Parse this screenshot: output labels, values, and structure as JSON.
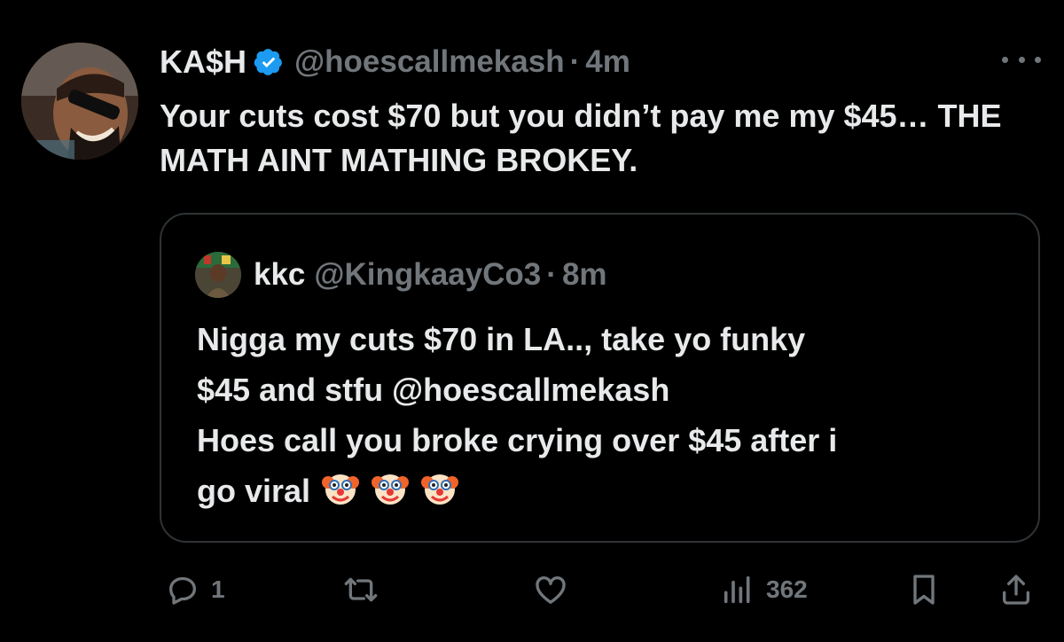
{
  "tweet": {
    "display_name": "KA$H",
    "handle": "@hoescallmekash",
    "separator": "·",
    "time": "4m",
    "text": "Your cuts cost $70 but you didn’t pay me my $45… THE MATH AINT MATHING BROKEY.",
    "avatar_icon": "profile-photo",
    "verified_icon": "verified-badge-icon",
    "more_icon": "more-options-icon"
  },
  "quote": {
    "display_name": "kkc",
    "handle": "@KingkaayCo3",
    "separator": "·",
    "time": "8m",
    "lines": [
      "Nigga my cuts $70 in LA.., take yo funky",
      "$45 and stfu @hoescallmekash",
      "Hoes call you broke crying over $45 after i",
      "go viral"
    ],
    "emoji": [
      "clown-face",
      "clown-face",
      "clown-face"
    ]
  },
  "actions": {
    "reply_count": "1",
    "retweet_count": "",
    "like_count": "",
    "views_count": "362",
    "icons": [
      "reply-icon",
      "retweet-icon",
      "like-icon",
      "views-icon",
      "bookmark-icon",
      "share-icon"
    ]
  },
  "colors": {
    "background": "#000000",
    "text": "#e7e9ea",
    "secondary": "#71767b",
    "border": "#2f3336",
    "verified": "#1d9bf0"
  }
}
